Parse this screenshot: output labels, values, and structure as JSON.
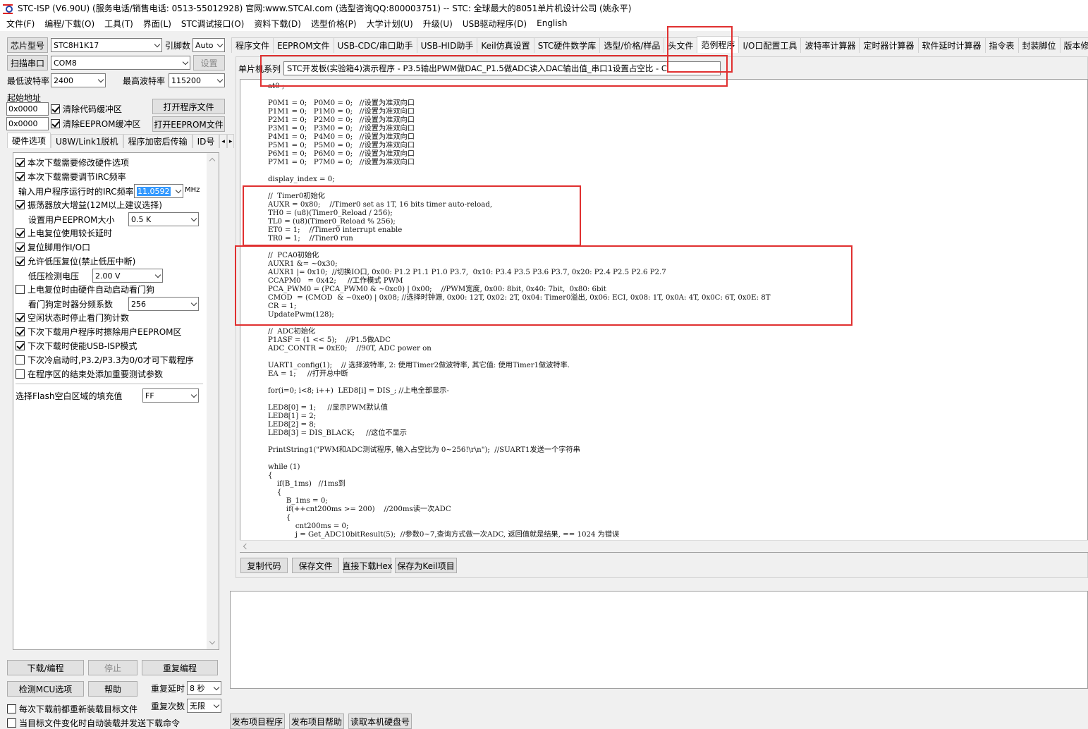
{
  "window": {
    "title": "STC-ISP (V6.90U) (服务电话/销售电话: 0513-55012928) 官网:www.STCAI.com  (选型咨询QQ:800003751) -- STC: 全球最大的8051单片机设计公司 (姚永平)"
  },
  "menu": [
    "文件(F)",
    "编程/下载(O)",
    "工具(T)",
    "界面(L)",
    "STC调试接口(O)",
    "资料下载(D)",
    "选型价格(P)",
    "大学计划(U)",
    "升级(U)",
    "USB驱动程序(D)",
    "English"
  ],
  "left": {
    "chip_btn": "芯片型号",
    "chip_value": "STC8H1K17",
    "pins_label": "引脚数",
    "pins_value": "Auto",
    "scan_btn": "扫描串口",
    "port_value": "COM8",
    "settings_btn": "设置",
    "min_baud_label": "最低波特率",
    "min_baud_value": "2400",
    "max_baud_label": "最高波特率",
    "max_baud_value": "115200",
    "start_addr_label": "起始地址",
    "addr1": "0x0000",
    "clear_code": "清除代码缓冲区",
    "open_prog": "打开程序文件",
    "addr2": "0x0000",
    "clear_eeprom": "清除EEPROM缓冲区",
    "open_eeprom": "打开EEPROM文件",
    "subtabs": [
      "硬件选项",
      "U8W/Link1脱机",
      "程序加密后传输",
      "ID号"
    ],
    "opts": {
      "o1": "本次下载需要修改硬件选项",
      "o2": "本次下载需要调节IRC频率",
      "irc_label": "输入用户程序运行时的IRC频率",
      "irc_value": "11.0592",
      "irc_unit": "MHz",
      "o3": "振荡器放大增益(12M以上建议选择)",
      "eeprom_label": "设置用户EEPROM大小",
      "eeprom_value": "0.5 K",
      "o4": "上电复位使用较长延时",
      "o5": "复位脚用作I/O口",
      "o6": "允许低压复位(禁止低压中断)",
      "lv_label": "低压检测电压",
      "lv_value": "2.00 V",
      "o7": "上电复位时由硬件自动启动看门狗",
      "wdt_label": "看门狗定时器分频系数",
      "wdt_value": "256",
      "o8": "空闲状态时停止看门狗计数",
      "o9": "下次下载用户程序时擦除用户EEPROM区",
      "o10": "下次下载时使能USB-ISP模式",
      "o11": "下次冷启动时,P3.2/P3.3为0/0才可下载程序",
      "o12": "在程序区的结束处添加重要测试参数",
      "fill_label": "选择Flash空白区域的填充值",
      "fill_value": "FF"
    },
    "download_btn": "下载/编程",
    "stop_btn": "停止",
    "reprogram_btn": "重复编程",
    "check_btn": "检测MCU选项",
    "help_btn": "帮助",
    "delay_label": "重复延时",
    "delay_value": "8 秒",
    "count_label": "重复次数",
    "count_value": "无限",
    "reload_each": "每次下载前都重新装载目标文件",
    "auto_send": "当目标文件变化时自动装载并发送下载命令"
  },
  "tabs": [
    "程序文件",
    "EEPROM文件",
    "USB-CDC/串口助手",
    "USB-HID助手",
    "Keil仿真设置",
    "STC硬件数学库",
    "选型/价格/样品",
    "头文件",
    "范例程序",
    "I/O口配置工具",
    "波特率计算器",
    "定时器计算器",
    "软件延时计算器",
    "指令表",
    "封装脚位",
    "版本修订记"
  ],
  "series_label": "单片机系列",
  "example_title": "STC开发板(实验箱4)演示程序 - P3.5输出PWM做DAC_P1.5做ADC读入DAC输出值_串口1设置占空比 - C",
  "code": "    at0 ;\n\n    P0M1 = 0;   P0M0 = 0;   //设置为准双向口\n    P1M1 = 0;   P1M0 = 0;   //设置为准双向口\n    P2M1 = 0;   P2M0 = 0;   //设置为准双向口\n    P3M1 = 0;   P3M0 = 0;   //设置为准双向口\n    P4M1 = 0;   P4M0 = 0;   //设置为准双向口\n    P5M1 = 0;   P5M0 = 0;   //设置为准双向口\n    P6M1 = 0;   P6M0 = 0;   //设置为准双向口\n    P7M1 = 0;   P7M0 = 0;   //设置为准双向口\n\n    display_index = 0;\n\n    //  Timer0初始化\n    AUXR = 0x80;    //Timer0 set as 1T, 16 bits timer auto-reload,\n    TH0 = (u8)(Timer0_Reload / 256);\n    TL0 = (u8)(Timer0_Reload % 256);\n    ET0 = 1;    //Timer0 interrupt enable\n    TR0 = 1;    //Tiner0 run\n\n    //  PCA0初始化\n    AUXR1 &= ~0x30;\n    AUXR1 |= 0x10;  //切换IO口, 0x00: P1.2 P1.1 P1.0 P3.7,  0x10: P3.4 P3.5 P3.6 P3.7, 0x20: P2.4 P2.5 P2.6 P2.7\n    CCAPM0   = 0x42;     //工作模式 PWM\n    PCA_PWM0 = (PCA_PWM0 & ~0xc0) | 0x00;    //PWM宽度, 0x00: 8bit, 0x40: 7bit,  0x80: 6bit\n    CMOD  = (CMOD  & ~0xe0) | 0x08; //选择时钟源, 0x00: 12T, 0x02: 2T, 0x04: Timer0溢出, 0x06: ECI, 0x08: 1T, 0x0A: 4T, 0x0C: 6T, 0x0E: 8T\n    CR = 1;\n    UpdatePwm(128);\n\n    //  ADC初始化\n    P1ASF = (1 << 5);    //P1.5做ADC\n    ADC_CONTR = 0xE0;    //90T, ADC power on\n\n    UART1_config(1);    // 选择波特率, 2: 使用Timer2做波特率, 其它值: 使用Timer1做波特率.\n    EA = 1;     //打开总中断\n\n    for(i=0; i<8; i++)  LED8[i] = DIS_; //上电全部显示-\n\n    LED8[0] = 1;     //显示PWM默认值\n    LED8[1] = 2;\n    LED8[2] = 8;\n    LED8[3] = DIS_BLACK;     //这位不显示\n\n    PrintString1(\"PWM和ADC测试程序, 输入占空比为 0~256!\\r\\n\");  //SUART1发送一个字符串\n\n    while (1)\n    {\n        if(B_1ms)   //1ms到\n        {\n            B_1ms = 0;\n            if(++cnt200ms >= 200)    //200ms读一次ADC\n            {\n                cnt200ms = 0;\n                j = Get_ADC10bitResult(5);  //参数0~7,查询方式做一次ADC, 返回值就是结果, == 1024 为错误",
  "code_buttons": [
    "复制代码",
    "保存文件",
    "直接下载Hex",
    "保存为Keil项目"
  ],
  "bottom_buttons": [
    "发布项目程序",
    "发布项目帮助",
    "读取本机硬盘号"
  ],
  "colors": {
    "highlight": "#e03030",
    "selection": "#3399ff"
  }
}
